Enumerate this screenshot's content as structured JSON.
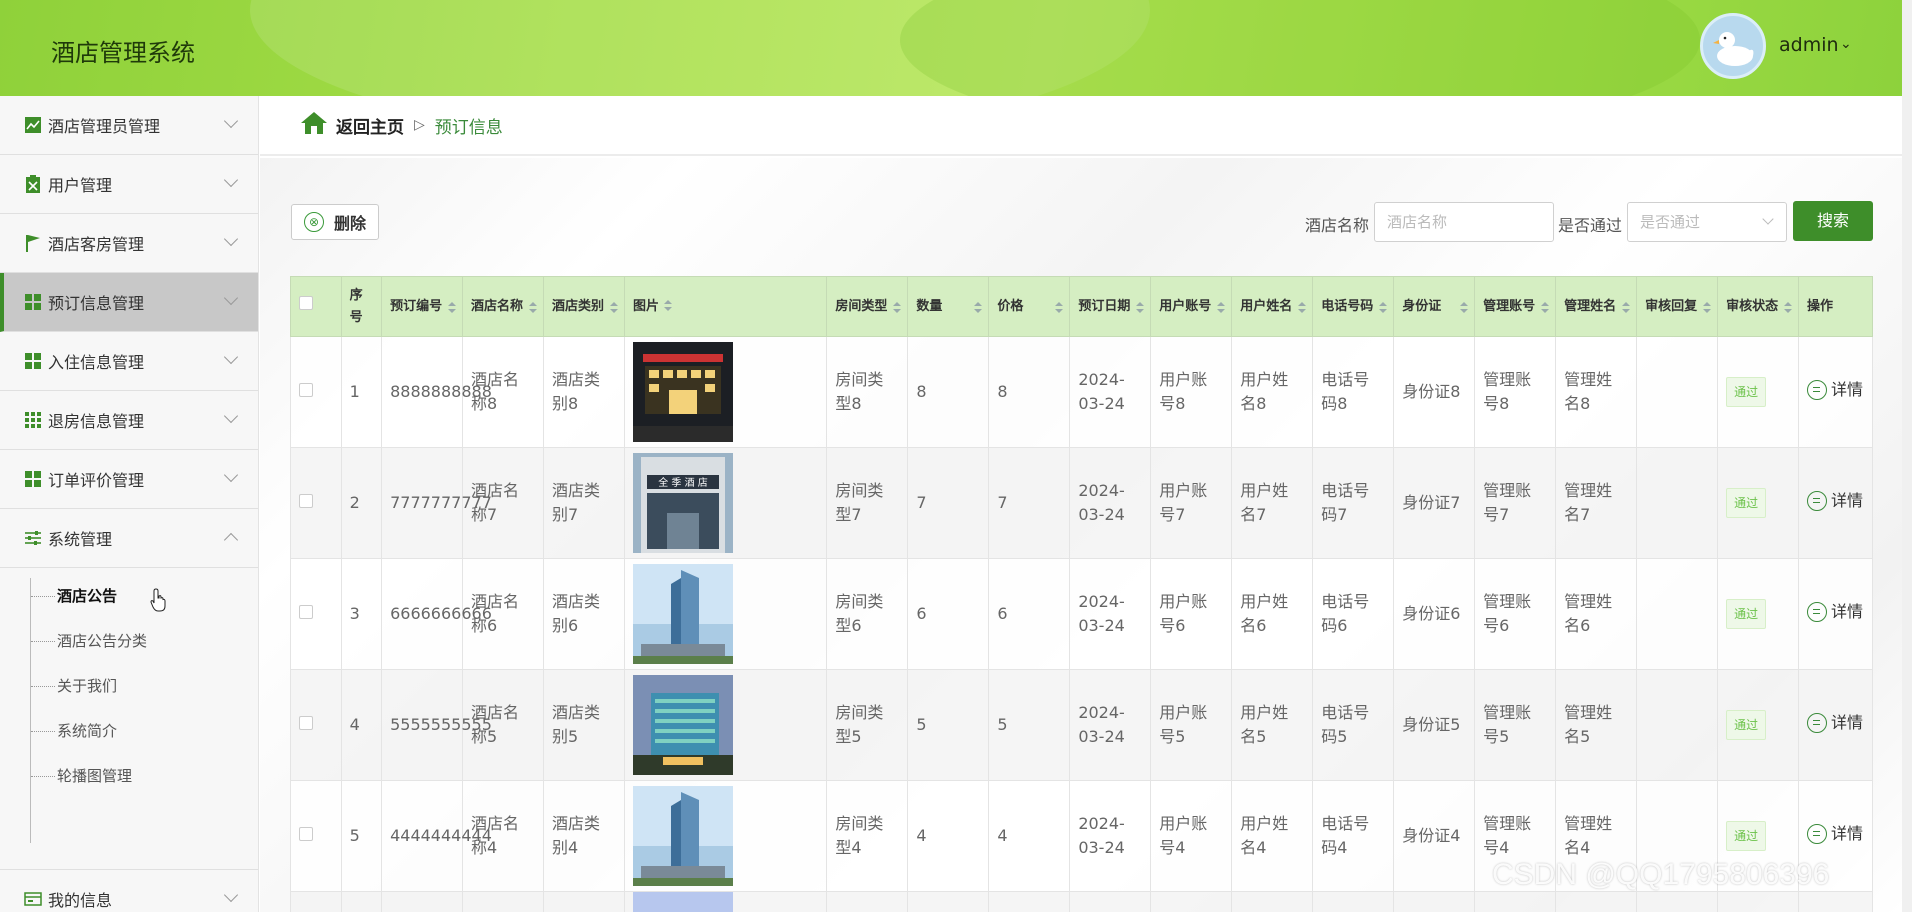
{
  "header": {
    "app_title": "酒店管理系统",
    "user_name": "admin",
    "user_caret": "⌄"
  },
  "sidebar": {
    "items": [
      {
        "label": "酒店管理员管理",
        "icon": "line-chart-icon"
      },
      {
        "label": "用户管理",
        "icon": "clipboard-icon"
      },
      {
        "label": "酒店客房管理",
        "icon": "flag-icon"
      },
      {
        "label": "预订信息管理",
        "icon": "grid-icon",
        "active": true
      },
      {
        "label": "入住信息管理",
        "icon": "grid-icon"
      },
      {
        "label": "退房信息管理",
        "icon": "grid-9-icon"
      },
      {
        "label": "订单评价管理",
        "icon": "grid-icon"
      },
      {
        "label": "系统管理",
        "icon": "sliders-icon",
        "expanded": true
      },
      {
        "label": "我的信息",
        "icon": "id-card-icon"
      }
    ],
    "submenu": [
      "酒店公告",
      "酒店公告分类",
      "关于我们",
      "系统简介",
      "轮播图管理"
    ]
  },
  "breadcrumb": {
    "home": "返回主页",
    "sep": "▷",
    "current": "预订信息"
  },
  "toolbar": {
    "delete_label": "删除",
    "delete_icon": "⊗",
    "hotel_name_label": "酒店名称",
    "hotel_name_placeholder": "酒店名称",
    "approved_label": "是否通过",
    "approved_placeholder": "是否通过",
    "search_label": "搜索"
  },
  "table": {
    "headers": [
      "序号",
      "预订编号",
      "酒店名称",
      "酒店类别",
      "图片",
      "房间类型",
      "数量",
      "价格",
      "预订日期",
      "用户账号",
      "用户姓名",
      "电话号码",
      "身份证",
      "管理账号",
      "管理姓名",
      "审核回复",
      "审核状态",
      "操作"
    ],
    "rows": [
      {
        "idx": "1",
        "order_no": "8888888888",
        "hotel": "酒店名称8",
        "category": "酒店类别8",
        "room": "房间类型8",
        "qty": "8",
        "price": "8",
        "date": "2024-03-24",
        "account": "用户账号8",
        "uname": "用户姓名8",
        "phone": "电话号码8",
        "idcard": "身份证8",
        "maccount": "管理账号8",
        "mname": "管理姓名8",
        "reply": "",
        "status": "通过",
        "action": "详情"
      },
      {
        "idx": "2",
        "order_no": "7777777777",
        "hotel": "酒店名称7",
        "category": "酒店类别7",
        "room": "房间类型7",
        "qty": "7",
        "price": "7",
        "date": "2024-03-24",
        "account": "用户账号7",
        "uname": "用户姓名7",
        "phone": "电话号码7",
        "idcard": "身份证7",
        "maccount": "管理账号7",
        "mname": "管理姓名7",
        "reply": "",
        "status": "通过",
        "action": "详情"
      },
      {
        "idx": "3",
        "order_no": "6666666666",
        "hotel": "酒店名称6",
        "category": "酒店类别6",
        "room": "房间类型6",
        "qty": "6",
        "price": "6",
        "date": "2024-03-24",
        "account": "用户账号6",
        "uname": "用户姓名6",
        "phone": "电话号码6",
        "idcard": "身份证6",
        "maccount": "管理账号6",
        "mname": "管理姓名6",
        "reply": "",
        "status": "通过",
        "action": "详情"
      },
      {
        "idx": "4",
        "order_no": "5555555555",
        "hotel": "酒店名称5",
        "category": "酒店类别5",
        "room": "房间类型5",
        "qty": "5",
        "price": "5",
        "date": "2024-03-24",
        "account": "用户账号5",
        "uname": "用户姓名5",
        "phone": "电话号码5",
        "idcard": "身份证5",
        "maccount": "管理账号5",
        "mname": "管理姓名5",
        "reply": "",
        "status": "通过",
        "action": "详情"
      },
      {
        "idx": "5",
        "order_no": "4444444444",
        "hotel": "酒店名称4",
        "category": "酒店类别4",
        "room": "房间类型4",
        "qty": "4",
        "price": "4",
        "date": "2024-03-24",
        "account": "用户账号4",
        "uname": "用户姓名4",
        "phone": "电话号码4",
        "idcard": "身份证4",
        "maccount": "管理账号4",
        "mname": "管理姓名4",
        "reply": "",
        "status": "通过",
        "action": "详情"
      }
    ]
  },
  "watermark": "CSDN @QQ1795806396",
  "colors": {
    "accent": "#3e8e2a",
    "header_green": "#a9e04a",
    "table_header": "#d5eec2",
    "status_green": "#6cc24a"
  }
}
